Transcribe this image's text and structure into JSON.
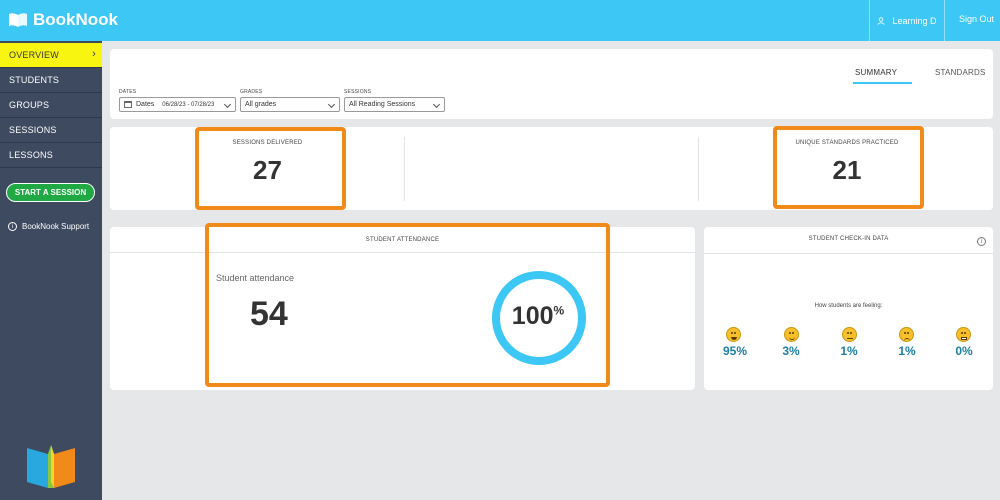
{
  "header": {
    "brand": "BookNook",
    "user": "Learning D",
    "signout": "Sign Out"
  },
  "sidebar": {
    "items": [
      {
        "label": "OVERVIEW",
        "active": true
      },
      {
        "label": "STUDENTS"
      },
      {
        "label": "GROUPS"
      },
      {
        "label": "SESSIONS"
      },
      {
        "label": "LESSONS"
      }
    ],
    "start_button": "START A SESSION",
    "support": "BookNook Support"
  },
  "tabs": {
    "summary": "SUMMARY",
    "standards": "STANDARDS"
  },
  "filters": {
    "dates_label": "DATES",
    "dates_prefix": "Dates",
    "dates_value": "06/28/23 - 07/28/23",
    "grades_label": "GRADES",
    "grades_value": "All grades",
    "sessions_label": "SESSIONS",
    "sessions_value": "All Reading Sessions"
  },
  "stats": {
    "sessions_label": "SESSIONS DELIVERED",
    "sessions_value": "27",
    "standards_label": "UNIQUE STANDARDS PRACTICED",
    "standards_value": "21"
  },
  "attendance": {
    "header": "STUDENT ATTENDANCE",
    "subtitle": "Student attendance",
    "value": "54",
    "percent": "100",
    "percent_symbol": "%",
    "ring_fraction": 1.0
  },
  "checkin": {
    "header": "STUDENT CHECK-IN DATA",
    "feeling": "How students are feeling:",
    "items": [
      {
        "icon": "grin-face-icon",
        "value": "95%"
      },
      {
        "icon": "smile-face-icon",
        "value": "3%"
      },
      {
        "icon": "neutral-face-icon",
        "value": "1%"
      },
      {
        "icon": "frown-face-icon",
        "value": "1%"
      },
      {
        "icon": "grimace-face-icon",
        "value": "0%"
      }
    ]
  },
  "colors": {
    "topbar": "#3cc7f5",
    "sidebar": "#3d4a5f",
    "active_nav": "#f8f510",
    "start_button": "#1fa843",
    "highlight": "#f28a1a",
    "ring": "#3cc7f5",
    "percent_text": "#1b7fa6"
  }
}
